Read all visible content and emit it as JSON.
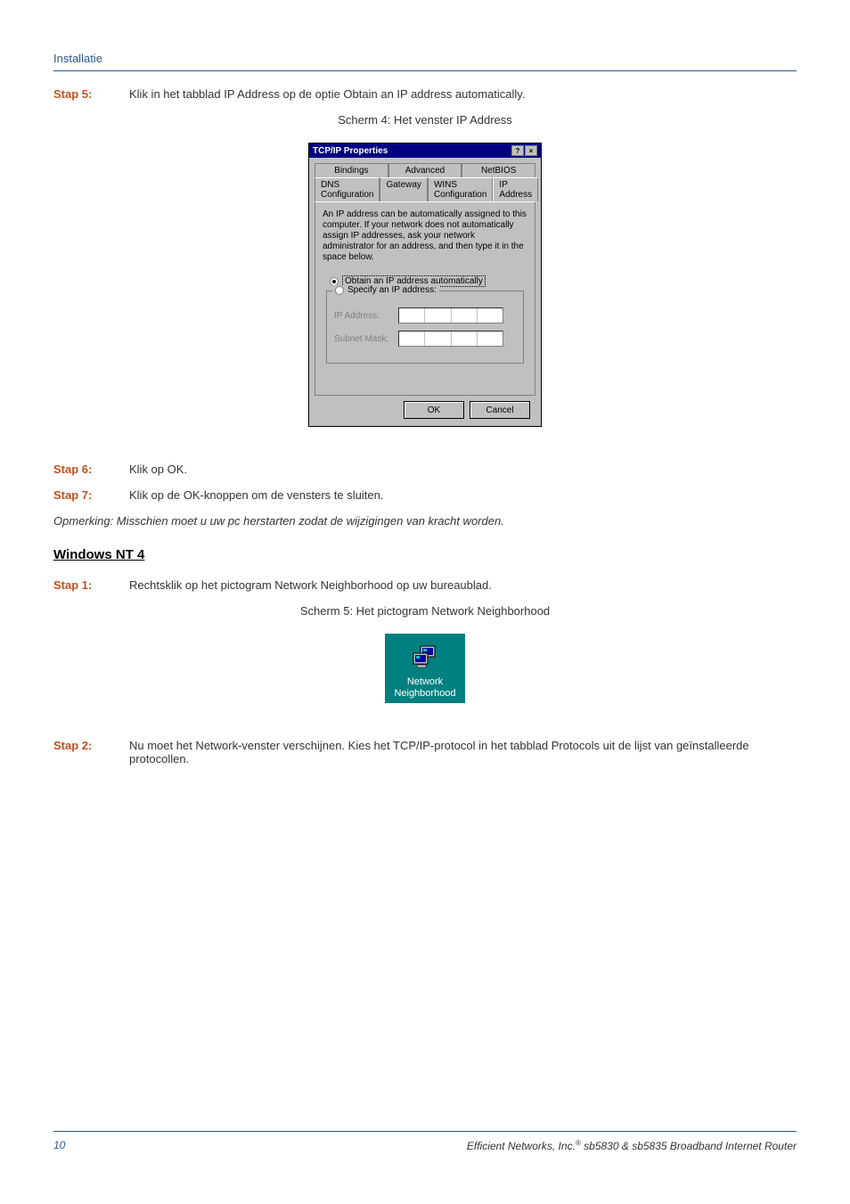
{
  "header": {
    "section": "Installatie"
  },
  "steps": {
    "s5": {
      "label": "Stap 5:",
      "text": "Klik in het tabblad IP Address op de optie Obtain an IP address automatically."
    },
    "s6": {
      "label": "Stap 6:",
      "text": "Klik op OK."
    },
    "s7": {
      "label": "Stap 7:",
      "text": "Klik op de OK-knoppen om de vensters te sluiten."
    },
    "s1b": {
      "label": "Stap 1:",
      "text": "Rechtsklik op het pictogram Network Neighborhood op uw bureaublad."
    },
    "s2b": {
      "label": "Stap 2:",
      "text": "Nu moet het Network-venster verschijnen. Kies het TCP/IP-protocol in het tabblad Protocols uit de lijst van geïnstalleerde protocollen."
    }
  },
  "captions": {
    "c4": "Scherm 4: Het venster IP Address",
    "c5": "Scherm 5: Het pictogram Network Neighborhood"
  },
  "dialog": {
    "title": "TCP/IP Properties",
    "help": "?",
    "close": "×",
    "tabs_row1": {
      "bindings": "Bindings",
      "advanced": "Advanced",
      "netbios": "NetBIOS"
    },
    "tabs_row2": {
      "dns": "DNS Configuration",
      "gateway": "Gateway",
      "wins": "WINS Configuration",
      "ip": "IP Address"
    },
    "info": "An IP address can be automatically assigned to this computer. If your network does not automatically assign IP addresses, ask your network administrator for an address, and then type it in the space below.",
    "radio_obtain": "Obtain an IP address automatically",
    "radio_specify": "Specify an IP address:",
    "ip_label": "IP Address:",
    "subnet_label": "Subnet Mask:",
    "ok": "OK",
    "cancel": "Cancel"
  },
  "note": "Opmerking: Misschien moet u uw pc herstarten zodat de wijzigingen van kracht worden.",
  "section_heading": "Windows NT 4",
  "nn": {
    "line1": "Network",
    "line2": "Neighborhood"
  },
  "footer": {
    "page": "10",
    "text_pre": "Efficient Networks, Inc.",
    "reg": "®",
    "text_post": " sb5830 & sb5835 Broadband Internet Router"
  }
}
